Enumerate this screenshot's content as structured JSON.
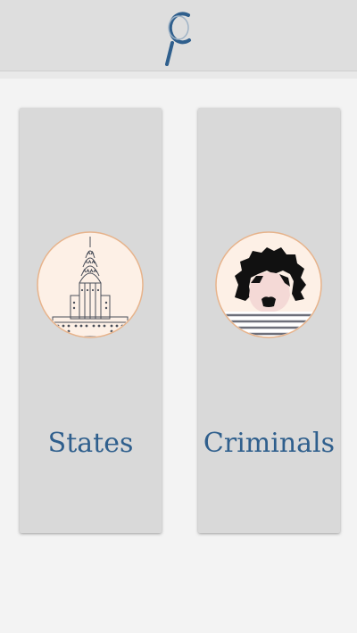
{
  "header": {
    "logo_icon": "magnifying-glass-c-logo-icon"
  },
  "cards": [
    {
      "label": "States",
      "icon": "skyscraper-building-icon"
    },
    {
      "label": "Criminals",
      "icon": "criminal-face-icon"
    }
  ],
  "colors": {
    "accent": "#2f5f8d",
    "header_bg": "#dedede",
    "card_bg": "#d9d9d9",
    "avatar_bg": "#fdf0e6",
    "avatar_border": "#e7b38b"
  }
}
